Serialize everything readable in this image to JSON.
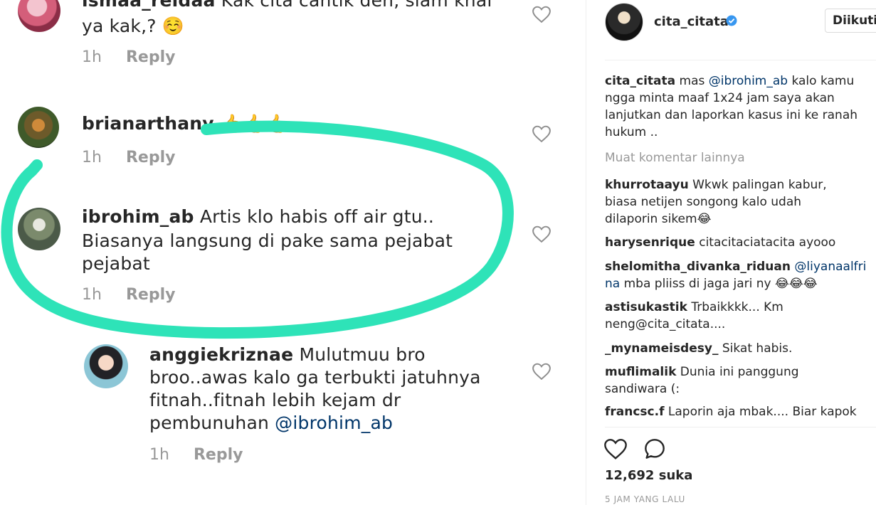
{
  "comments": [
    {
      "username": "ismaa_reidaa",
      "text": "Kak cita cantik deh, siam khai",
      "text2": "ya kak,? ☺️",
      "time": "1h",
      "reply": "Reply"
    },
    {
      "username": "brianarthany",
      "text": "👍👍👍",
      "time": "1h",
      "reply": "Reply"
    },
    {
      "username": "ibrohim_ab",
      "text": "Artis klo habis off air gtu..",
      "text2": "Biasanya langsung di pake sama pejabat",
      "text3": "pejabat",
      "time": "1h",
      "reply": "Reply"
    },
    {
      "username": "anggiekriznae",
      "text": "Mulutmuu bro",
      "text2": "broo..awas kalo ga terbukti jatuhnya",
      "text3": "fitnah..fitnah lebih kejam dr",
      "text4": "pembunuhan",
      "mention": "@ibrohim_ab",
      "time": "1h",
      "reply": "Reply"
    }
  ],
  "post": {
    "username": "cita_citata",
    "follow_label": "Diikuti",
    "caption_user": "cita_citata",
    "caption_1": "mas",
    "caption_mention": "@ibrohim_ab",
    "caption_2": "kalo kamu",
    "caption_l2": "ngga minta maaf 1x24 jam saya akan",
    "caption_l3": "lanjutkan dan laporkan kasus ini ke ranah",
    "caption_l4": "hukum ..",
    "load_more": "Muat komentar lainnya",
    "likes": "12,692 suka",
    "time_ago": "5 JAM YANG LALU"
  },
  "side_comments": [
    {
      "u": "khurrotaayu",
      "l1": "Wkwk palingan kabur,",
      "l2": "biasa netijen songong kalo udah",
      "l3": "dilaporin sikem😂"
    },
    {
      "u": "harysenrique",
      "l1": "citacitaciatacita ayooo"
    },
    {
      "u": "shelomitha_divanka_riduan",
      "mention": "@liyanaalfri",
      "l2mention": "na",
      "l2": "mba pliiss di jaga jari ny 😂😂😂"
    },
    {
      "u": "astisukastik",
      "l1": "Trbaikkkk... Km",
      "l2": "neng@cita_citata...."
    },
    {
      "u": "_mynameisdesy_",
      "l1": "Sikat habis."
    },
    {
      "u": "muflimalik",
      "l1": "Dunia ini panggung",
      "l2": "sandiwara (:"
    },
    {
      "u": "francsc.f",
      "l1": "Laporin aja mbak.... Biar kapok"
    }
  ],
  "colors": {
    "highlight": "#2ee3b8",
    "mention": "#003569",
    "verified": "#3897f0"
  },
  "icons": [
    "heart-icon",
    "comment-icon",
    "verified-icon"
  ]
}
